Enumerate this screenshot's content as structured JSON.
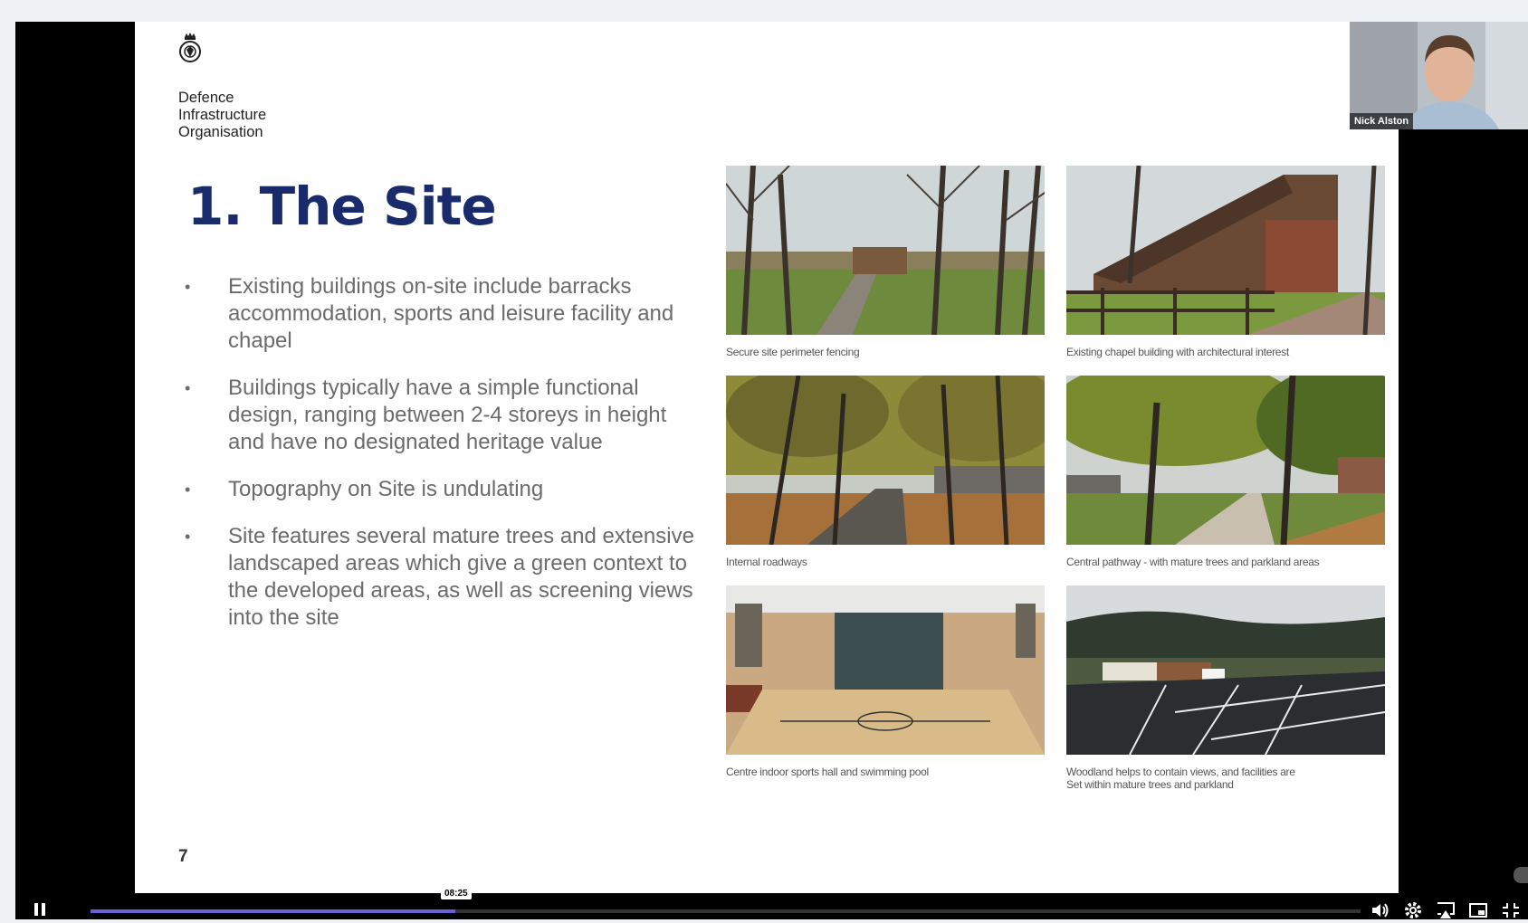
{
  "slide": {
    "org_name_lines": [
      "Defence",
      "Infrastructure",
      "Organisation"
    ],
    "title": "1. The Site",
    "bullets": [
      "Existing buildings on-site include barracks accommodation, sports and leisure facility and chapel",
      "Buildings typically have a simple functional design, ranging between 2-4 storeys in height and have no designated heritage value",
      "Topography on Site is undulating",
      "Site features several mature trees and extensive landscaped areas which give a green context to the developed areas, as well as screening views into the site"
    ],
    "bullet_glyph": "•",
    "photos": [
      {
        "caption": "Secure site perimeter fencing",
        "subject": "tree-lined path"
      },
      {
        "caption": "Existing chapel building with architectural interest",
        "subject": "chapel building"
      },
      {
        "caption": "Internal roadways",
        "subject": "tree-lined road"
      },
      {
        "caption": "Central pathway - with mature trees and parkland areas",
        "subject": "parkland pathway"
      },
      {
        "caption": "Centre indoor sports hall and swimming pool",
        "subject": "sports hall interior"
      },
      {
        "caption": "Woodland helps to contain views, and facilities are Set within mature trees and parkland",
        "subject": "car park with woodland"
      }
    ],
    "page_number": "7"
  },
  "webcam": {
    "participant_name": "Nick Alston"
  },
  "player": {
    "current_time": "08:25",
    "progress": 0.287,
    "icons": [
      "pause-icon",
      "volume-icon",
      "gear-icon",
      "airplay-icon",
      "picture-in-picture-icon",
      "exit-fullscreen-icon"
    ],
    "accent_color": "#6b5fd8"
  },
  "colors": {
    "title": "#1a2b6b",
    "bullet_text": "#6b6b6b"
  }
}
